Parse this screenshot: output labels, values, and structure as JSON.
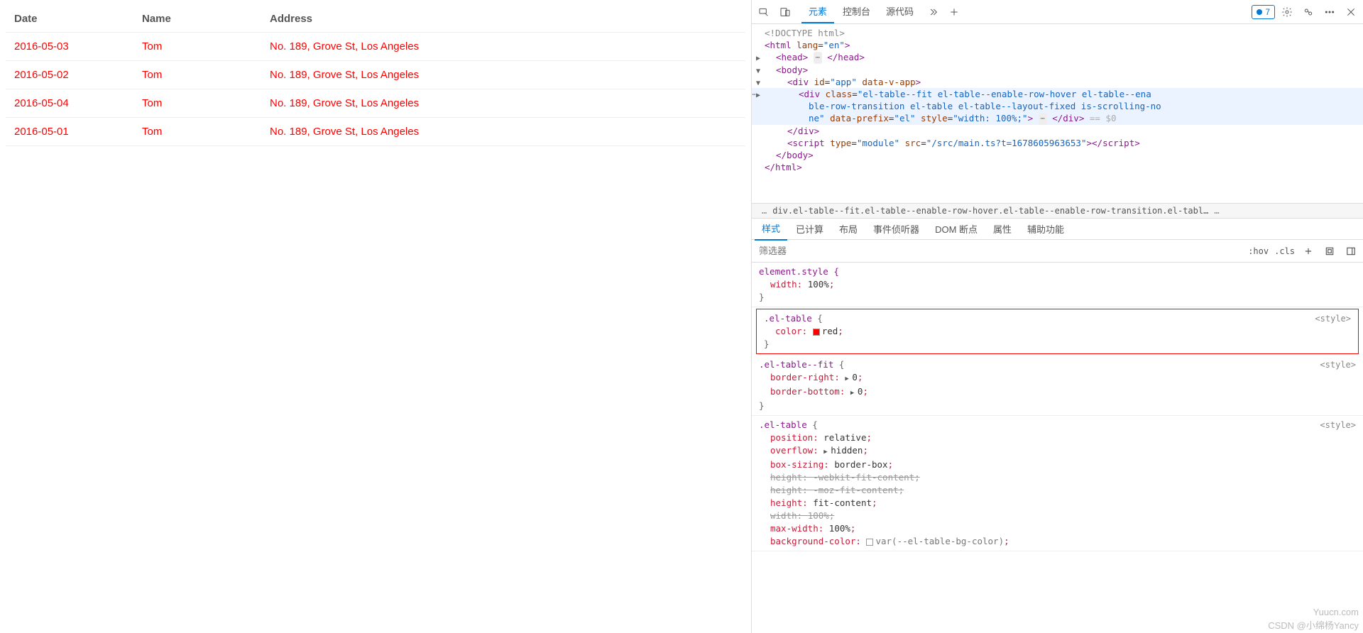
{
  "table": {
    "headers": [
      "Date",
      "Name",
      "Address"
    ],
    "rows": [
      {
        "date": "2016-05-03",
        "name": "Tom",
        "address": "No. 189, Grove St, Los Angeles"
      },
      {
        "date": "2016-05-02",
        "name": "Tom",
        "address": "No. 189, Grove St, Los Angeles"
      },
      {
        "date": "2016-05-04",
        "name": "Tom",
        "address": "No. 189, Grove St, Los Angeles"
      },
      {
        "date": "2016-05-01",
        "name": "Tom",
        "address": "No. 189, Grove St, Los Angeles"
      }
    ]
  },
  "devtools": {
    "tabs": [
      "元素",
      "控制台",
      "源代码"
    ],
    "badge_count": "7",
    "dom": {
      "l0": "<!DOCTYPE html>",
      "l1_open": "<html ",
      "l1_attr": "lang",
      "l1_val": "\"en\"",
      "l1_close": ">",
      "l2a": "<head>",
      "l2b": "</head>",
      "l3": "<body>",
      "l4a": "<div ",
      "l4_id": "id",
      "l4_idv": "\"app\"",
      "l4_dv": " data-v-app",
      "l4b": ">",
      "l5a": "<div ",
      "l5_cls": "class",
      "l5_clsv": "\"el-table--fit el-table--enable-row-hover el-table--ena",
      "l5_cont": "ble-row-transition el-table el-table--layout-fixed is-scrolling-no",
      "l5_cont2a": "ne\"",
      "l5_dp": " data-prefix",
      "l5_dpv": "\"el\"",
      "l5_st": " style",
      "l5_stv": "\"width: 100%;\"",
      "l5_end": ">",
      "l5_close": "</div>",
      "l5_tail": " == $0",
      "l6": "</div>",
      "l7a": "<script ",
      "l7_t": "type",
      "l7_tv": "\"module\"",
      "l7_s": " src",
      "l7_sv": "\"/src/main.ts?t=1678605963653\"",
      "l7b": ">",
      "l7c": "</script>",
      "l8": "</body>",
      "l9": "</html>"
    },
    "breadcrumb": "div.el-table--fit.el-table--enable-row-hover.el-table--enable-row-transition.el-tabl…",
    "styles_tabs": [
      "样式",
      "已计算",
      "布局",
      "事件侦听器",
      "DOM 断点",
      "属性",
      "辅助功能"
    ],
    "filter_placeholder": "筛选器",
    "hov": ":hov",
    "cls": ".cls",
    "rules": {
      "elstyle_sel": "element.style {",
      "elstyle_p1": "width",
      "elstyle_v1": "100%",
      "r1_sel": ".el-table",
      "r1_p": "color",
      "r1_v": "red",
      "r2_sel": ".el-table--fit",
      "r2_p1": "border-right",
      "r2_v1": "0",
      "r2_p2": "border-bottom",
      "r2_v2": "0",
      "r3_sel": ".el-table",
      "r3_p1": "position",
      "r3_v1": "relative",
      "r3_p2": "overflow",
      "r3_v2": "hidden",
      "r3_p3": "box-sizing",
      "r3_v3": "border-box",
      "r3_p4": "height",
      "r3_v4": "-webkit-fit-content",
      "r3_p5": "height",
      "r3_v5": "-moz-fit-content",
      "r3_p6": "height",
      "r3_v6": "fit-content",
      "r3_p7": "width",
      "r3_v7": "100%",
      "r3_p8": "max-width",
      "r3_v8": "100%",
      "r3_p9": "background-color",
      "r3_v9": "var(--el-table-bg-color)",
      "src": "<style>"
    }
  },
  "watermark1": "Yuucn.com",
  "watermark2": "CSDN @小绵杨Yancy"
}
